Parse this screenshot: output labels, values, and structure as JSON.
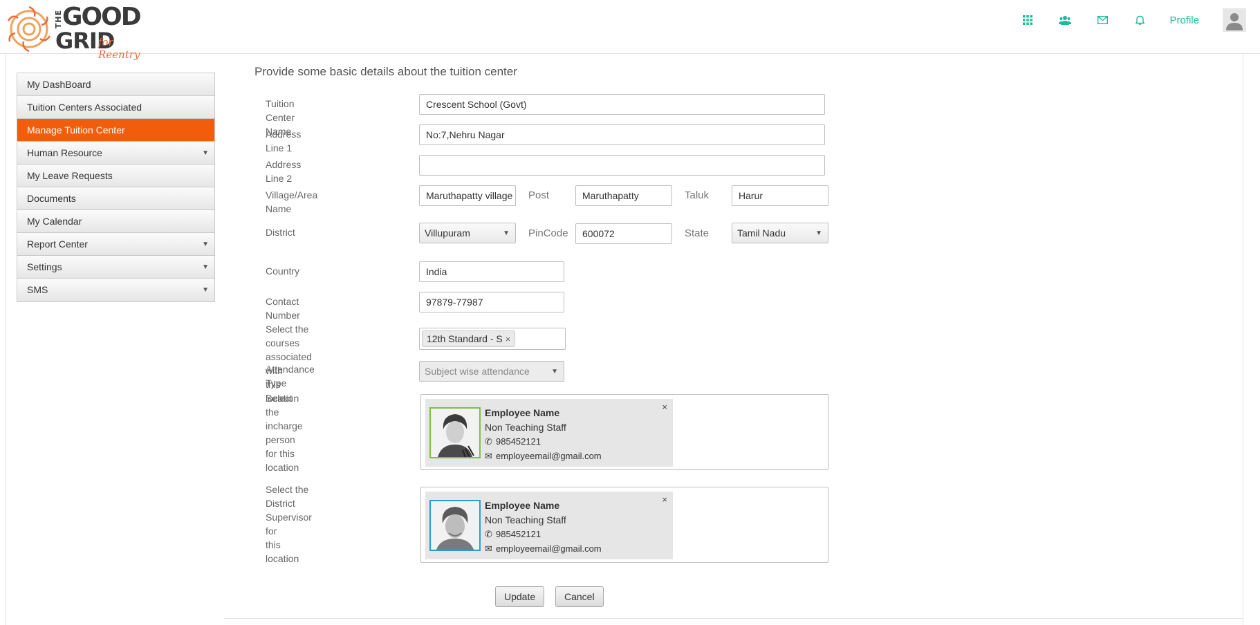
{
  "header": {
    "logo": {
      "the": "THE",
      "good": "GOOD",
      "grid": "GRID",
      "tagline": "for Reentry"
    },
    "nav": {
      "profile_label": "Profile"
    },
    "icons": [
      "apps-grid-icon",
      "users-icon",
      "mail-icon",
      "bell-icon"
    ]
  },
  "sidebar": {
    "items": [
      {
        "label": "My DashBoard",
        "active": false,
        "has_arrow": false
      },
      {
        "label": "Tuition Centers Associated",
        "active": false,
        "has_arrow": false
      },
      {
        "label": "Manage Tuition Center",
        "active": true,
        "has_arrow": false
      },
      {
        "label": "Human Resource",
        "active": false,
        "has_arrow": true
      },
      {
        "label": "My Leave Requests",
        "active": false,
        "has_arrow": false
      },
      {
        "label": "Documents",
        "active": false,
        "has_arrow": false
      },
      {
        "label": "My Calendar",
        "active": false,
        "has_arrow": false
      },
      {
        "label": "Report Center",
        "active": false,
        "has_arrow": true
      },
      {
        "label": "Settings",
        "active": false,
        "has_arrow": true
      },
      {
        "label": "SMS",
        "active": false,
        "has_arrow": true
      }
    ],
    "arrow_glyph": "▼"
  },
  "form": {
    "title": "Provide some basic details about the tuition center",
    "center_name": {
      "label": "Tuition Center Name",
      "value": "Crescent School (Govt)"
    },
    "address1": {
      "label": "Address Line 1",
      "value": "No:7,Nehru Nagar"
    },
    "address2": {
      "label": "Address Line 2",
      "value": ""
    },
    "village": {
      "label": "Village/Area Name",
      "value": "Maruthapatty village"
    },
    "post": {
      "label": "Post",
      "value": "Maruthapatty"
    },
    "taluk": {
      "label": "Taluk",
      "value": "Harur"
    },
    "district": {
      "label": "District",
      "value": "Villupuram"
    },
    "pincode": {
      "label": "PinCode",
      "value": "600072"
    },
    "state": {
      "label": "State",
      "value": "Tamil Nadu"
    },
    "country": {
      "label": "Country",
      "value": "India"
    },
    "contact": {
      "label": "Contact Number",
      "value": "97879-77987"
    },
    "courses": {
      "label_line1": "Select the courses associated with",
      "label_line2": "this location",
      "tags": [
        "12th Standard - S"
      ],
      "remove_glyph": "×"
    },
    "attendance": {
      "label": "Attendance Type",
      "value": "Subject wise attendance"
    },
    "incharge": {
      "label_line1": "Select the incharge person for this",
      "label_line2": "location",
      "name": "Employee Name",
      "role": "Non Teaching Staff",
      "phone": "985452121",
      "email": "employeemail@gmail.com",
      "close_glyph": "×"
    },
    "supervisor": {
      "label_line1": "Select the District Supervisor for",
      "label_line2": "this location",
      "name": "Employee Name",
      "role": "Non Teaching Staff",
      "phone": "985452121",
      "email": "employeemail@gmail.com",
      "close_glyph": "×"
    },
    "buttons": {
      "update": "Update",
      "cancel": "Cancel"
    }
  },
  "colors": {
    "accent": "#1abc9c",
    "active_menu": "#f25d0b",
    "logo_orange": "#e96b3c"
  }
}
